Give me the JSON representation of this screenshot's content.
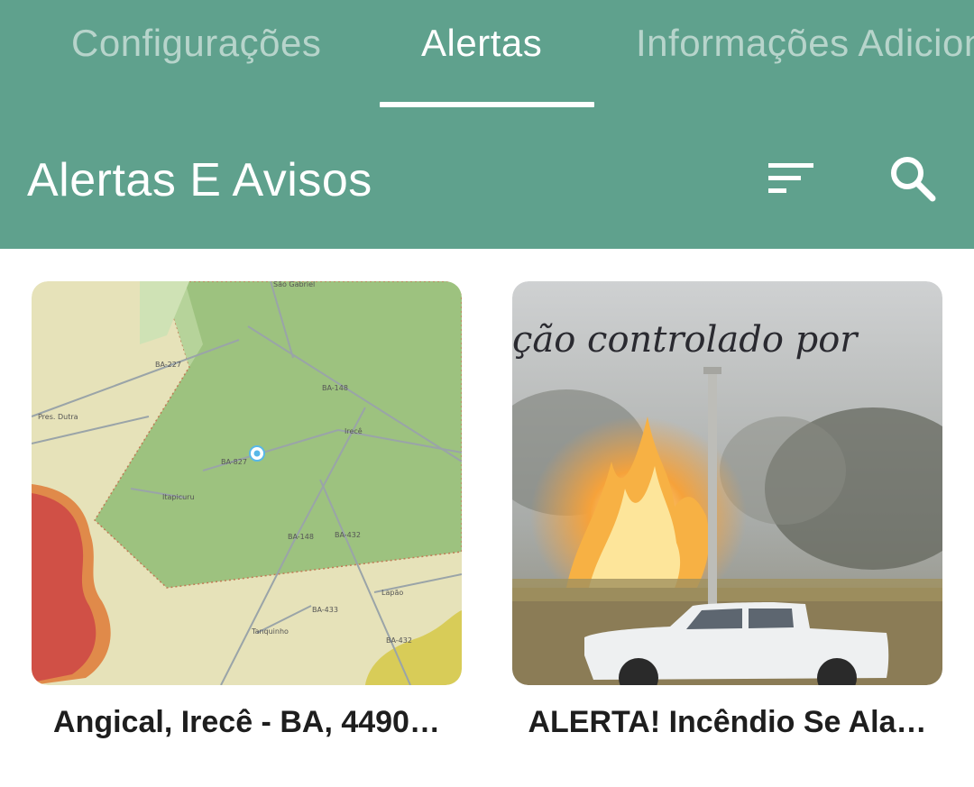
{
  "tabs": [
    {
      "label": "Configurações",
      "active": false
    },
    {
      "label": "Alertas",
      "active": true
    },
    {
      "label": "Informações Adicionais",
      "active": false
    }
  ],
  "appbar": {
    "title": "Alertas E Avisos",
    "filter_icon": "sort-icon",
    "search_icon": "search-icon"
  },
  "alerts": [
    {
      "title": "Angical, Irecê - BA, 4490…",
      "thumbnail": "map-thumbnail"
    },
    {
      "title": "ALERTA! Incêndio Se Ala…",
      "thumbnail": "fire-photo-thumbnail"
    }
  ],
  "map_labels": {
    "top": "São Gabriel",
    "road1": "BA-227",
    "city1": "Pres. Dutra",
    "road2": "BA-148",
    "road3": "BA-827",
    "city2": "Irecê",
    "city3": "Itapicuru",
    "road4": "BA-148",
    "road5": "BA-432",
    "city4": "Lapão",
    "road6": "BA-433",
    "city5": "Tanquinho",
    "road7": "BA-432"
  },
  "photo_caption": "ção controlado por",
  "colors": {
    "primary": "#5fa18d",
    "on_primary": "#ffffff",
    "title_text": "#1e1e1e"
  }
}
